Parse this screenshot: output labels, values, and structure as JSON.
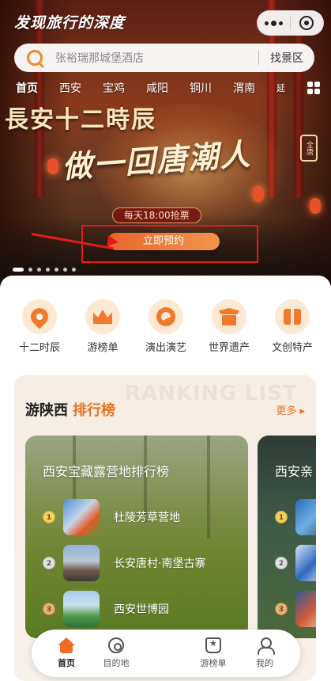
{
  "app": {
    "logo": "发现旅行的深度"
  },
  "search": {
    "placeholder": "张裕瑞那城堡酒店",
    "button": "找景区"
  },
  "city_tabs": [
    "首页",
    "西安",
    "宝鸡",
    "咸阳",
    "铜川",
    "渭南",
    "延"
  ],
  "banner": {
    "title": "長安十二時辰",
    "slogan": "做一回唐潮人",
    "seal": "全唐",
    "sale_time": "每天18:00抢票",
    "book_button": "立即预约",
    "slide_count": 7,
    "active_slide": 1
  },
  "categories": [
    {
      "label": "十二时辰",
      "icon": "location-pin-icon"
    },
    {
      "label": "游榜单",
      "icon": "crown-icon"
    },
    {
      "label": "演出演艺",
      "icon": "performance-icon"
    },
    {
      "label": "世界遗产",
      "icon": "temple-icon"
    },
    {
      "label": "文创特产",
      "icon": "gift-icon"
    }
  ],
  "ranking": {
    "watermark": "RANKING LIST",
    "title_prefix": "游陕西",
    "title_highlight": "排行榜",
    "more": "更多 ▸",
    "lists": [
      {
        "title": "西安宝藏露营地排行榜",
        "items": [
          {
            "rank": "1",
            "name": "杜陵芳草营地"
          },
          {
            "rank": "2",
            "name": "长安唐村·南堡古寨"
          },
          {
            "rank": "3",
            "name": "西安世博园"
          }
        ]
      },
      {
        "title": "西安亲",
        "items": [
          {
            "rank": "1",
            "name": ""
          },
          {
            "rank": "2",
            "name": ""
          },
          {
            "rank": "3",
            "name": ""
          }
        ]
      }
    ]
  },
  "bottom_nav": [
    {
      "label": "首页",
      "icon": "home-icon",
      "active": true
    },
    {
      "label": "目的地",
      "icon": "destination-icon",
      "active": false
    },
    {
      "label": "游榜单",
      "icon": "ranking-icon",
      "active": false
    },
    {
      "label": "我的",
      "icon": "profile-icon",
      "active": false
    }
  ],
  "colors": {
    "accent": "#f07a2a",
    "highlight_annotation": "#e31b1b"
  }
}
